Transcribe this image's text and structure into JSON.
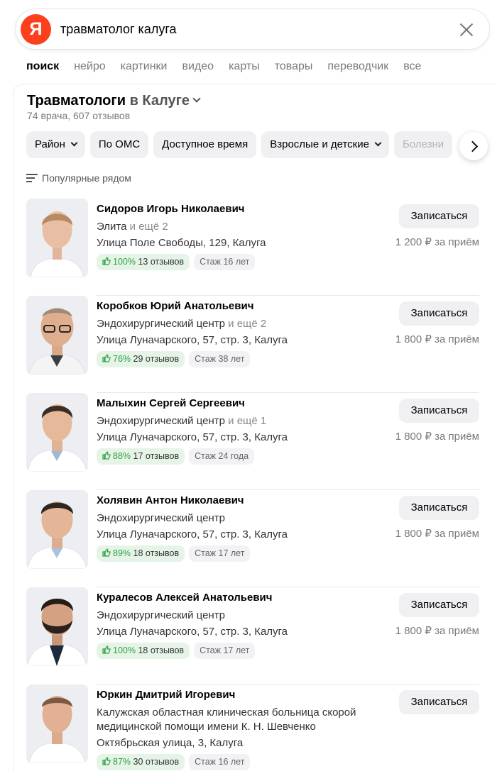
{
  "search": {
    "query": "травматолог калуга",
    "logo_text": "Я"
  },
  "tabs": [
    "поиск",
    "нейро",
    "картинки",
    "видео",
    "карты",
    "товары",
    "переводчик",
    "все"
  ],
  "header": {
    "title": "Травматологи",
    "title_city": "в Калуге",
    "subtitle": "74 врача, 607 отзывов"
  },
  "filters": [
    "Район",
    "По ОМС",
    "Доступное время",
    "Взрослые и детские",
    "Болезни"
  ],
  "sort_label": "Популярные рядом",
  "book_label": "Записаться",
  "doctors": [
    {
      "name": "Сидоров Игорь Николаевич",
      "clinic": "Элита",
      "more": "и ещё 2",
      "address": "Улица Поле Свободы, 129, Калуга",
      "rating": "100%",
      "reviews": "13 отзывов",
      "experience": "Стаж 16 лет",
      "price": "1 200 ₽ за приём"
    },
    {
      "name": "Коробков Юрий Анатольевич",
      "clinic": "Эндохирургический центр",
      "more": "и ещё 2",
      "address": "Улица Луначарского, 57, стр. 3, Калуга",
      "rating": "76%",
      "reviews": "29 отзывов",
      "experience": "Стаж 38 лет",
      "price": "1 800 ₽ за приём"
    },
    {
      "name": "Малыхин Сергей Сергеевич",
      "clinic": "Эндохирургический центр",
      "more": "и ещё 1",
      "address": "Улица Луначарского, 57, стр. 3, Калуга",
      "rating": "88%",
      "reviews": "17 отзывов",
      "experience": "Стаж 24 года",
      "price": "1 800 ₽ за приём"
    },
    {
      "name": "Холявин Антон Николаевич",
      "clinic": "Эндохирургический центр",
      "more": "",
      "address": "Улица Луначарского, 57, стр. 3, Калуга",
      "rating": "89%",
      "reviews": "18 отзывов",
      "experience": "Стаж 17 лет",
      "price": "1 800 ₽ за приём"
    },
    {
      "name": "Куралесов Алексей Анатольевич",
      "clinic": "Эндохирургический центр",
      "more": "",
      "address": "Улица Луначарского, 57, стр. 3, Калуга",
      "rating": "100%",
      "reviews": "18 отзывов",
      "experience": "Стаж 17 лет",
      "price": "1 800 ₽ за приём"
    },
    {
      "name": "Юркин Дмитрий Игоревич",
      "clinic": "Калужская областная клиническая больница скорой медицинской помощи имени К. Н. Шевченко",
      "more": "",
      "address": "Октябрьская улица, 3, Калуга",
      "rating": "87%",
      "reviews": "30 отзывов",
      "experience": "Стаж 16 лет",
      "price": ""
    }
  ]
}
